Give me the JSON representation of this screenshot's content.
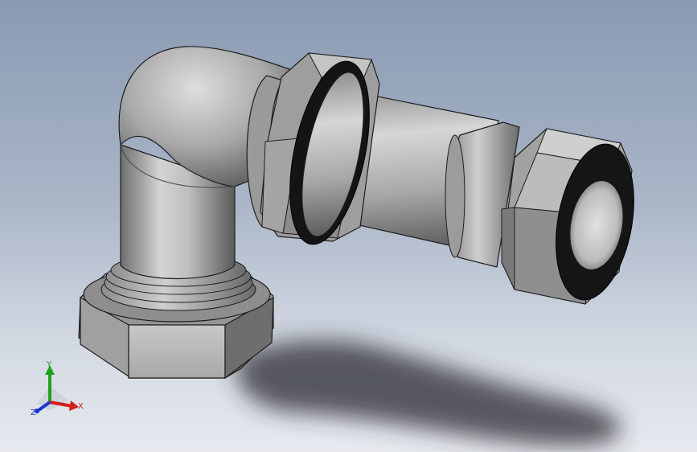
{
  "viewport": {
    "background_top": "#8a9ab2",
    "background_bottom": "#e6e9ee"
  },
  "model": {
    "parts": [
      "elbow-pipe",
      "bottom-hex-nut",
      "bulkhead-hex-nut",
      "tube",
      "end-hex-nut"
    ],
    "material_color": "#b8b8b8"
  },
  "triad": {
    "x_label": "X",
    "y_label": "Y",
    "z_label": "Z",
    "x_color": "#d21c1c",
    "y_color": "#1fa11f",
    "z_color": "#1c35c8"
  }
}
